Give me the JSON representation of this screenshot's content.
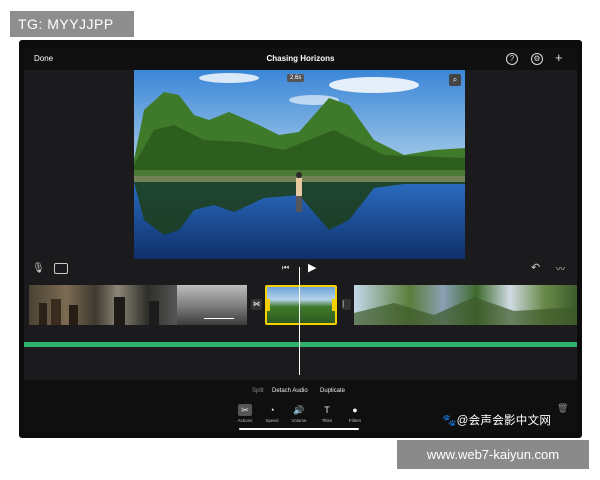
{
  "watermark_top": "TG: MYYJJPP",
  "watermark_cn": "@会声会影中文网",
  "watermark_bottom": "www.web7-kaiyun.com",
  "topbar": {
    "done_label": "Done",
    "project_title": "Chasing Horizons"
  },
  "preview": {
    "timecode": "2.6s"
  },
  "clip_actions": {
    "split": "Split",
    "detach_audio": "Detach Audio",
    "duplicate": "Duplicate"
  },
  "tools": [
    {
      "label": "Actions",
      "icon": "scissors-icon"
    },
    {
      "label": "Speed",
      "icon": "speedometer-icon"
    },
    {
      "label": "Volume",
      "icon": "speaker-icon"
    },
    {
      "label": "Titles",
      "icon": "title-t-icon"
    },
    {
      "label": "Filters",
      "icon": "filters-icon"
    }
  ],
  "colors": {
    "audio_track": "#2fb36a",
    "selected_clip_border": "#f5d000"
  }
}
